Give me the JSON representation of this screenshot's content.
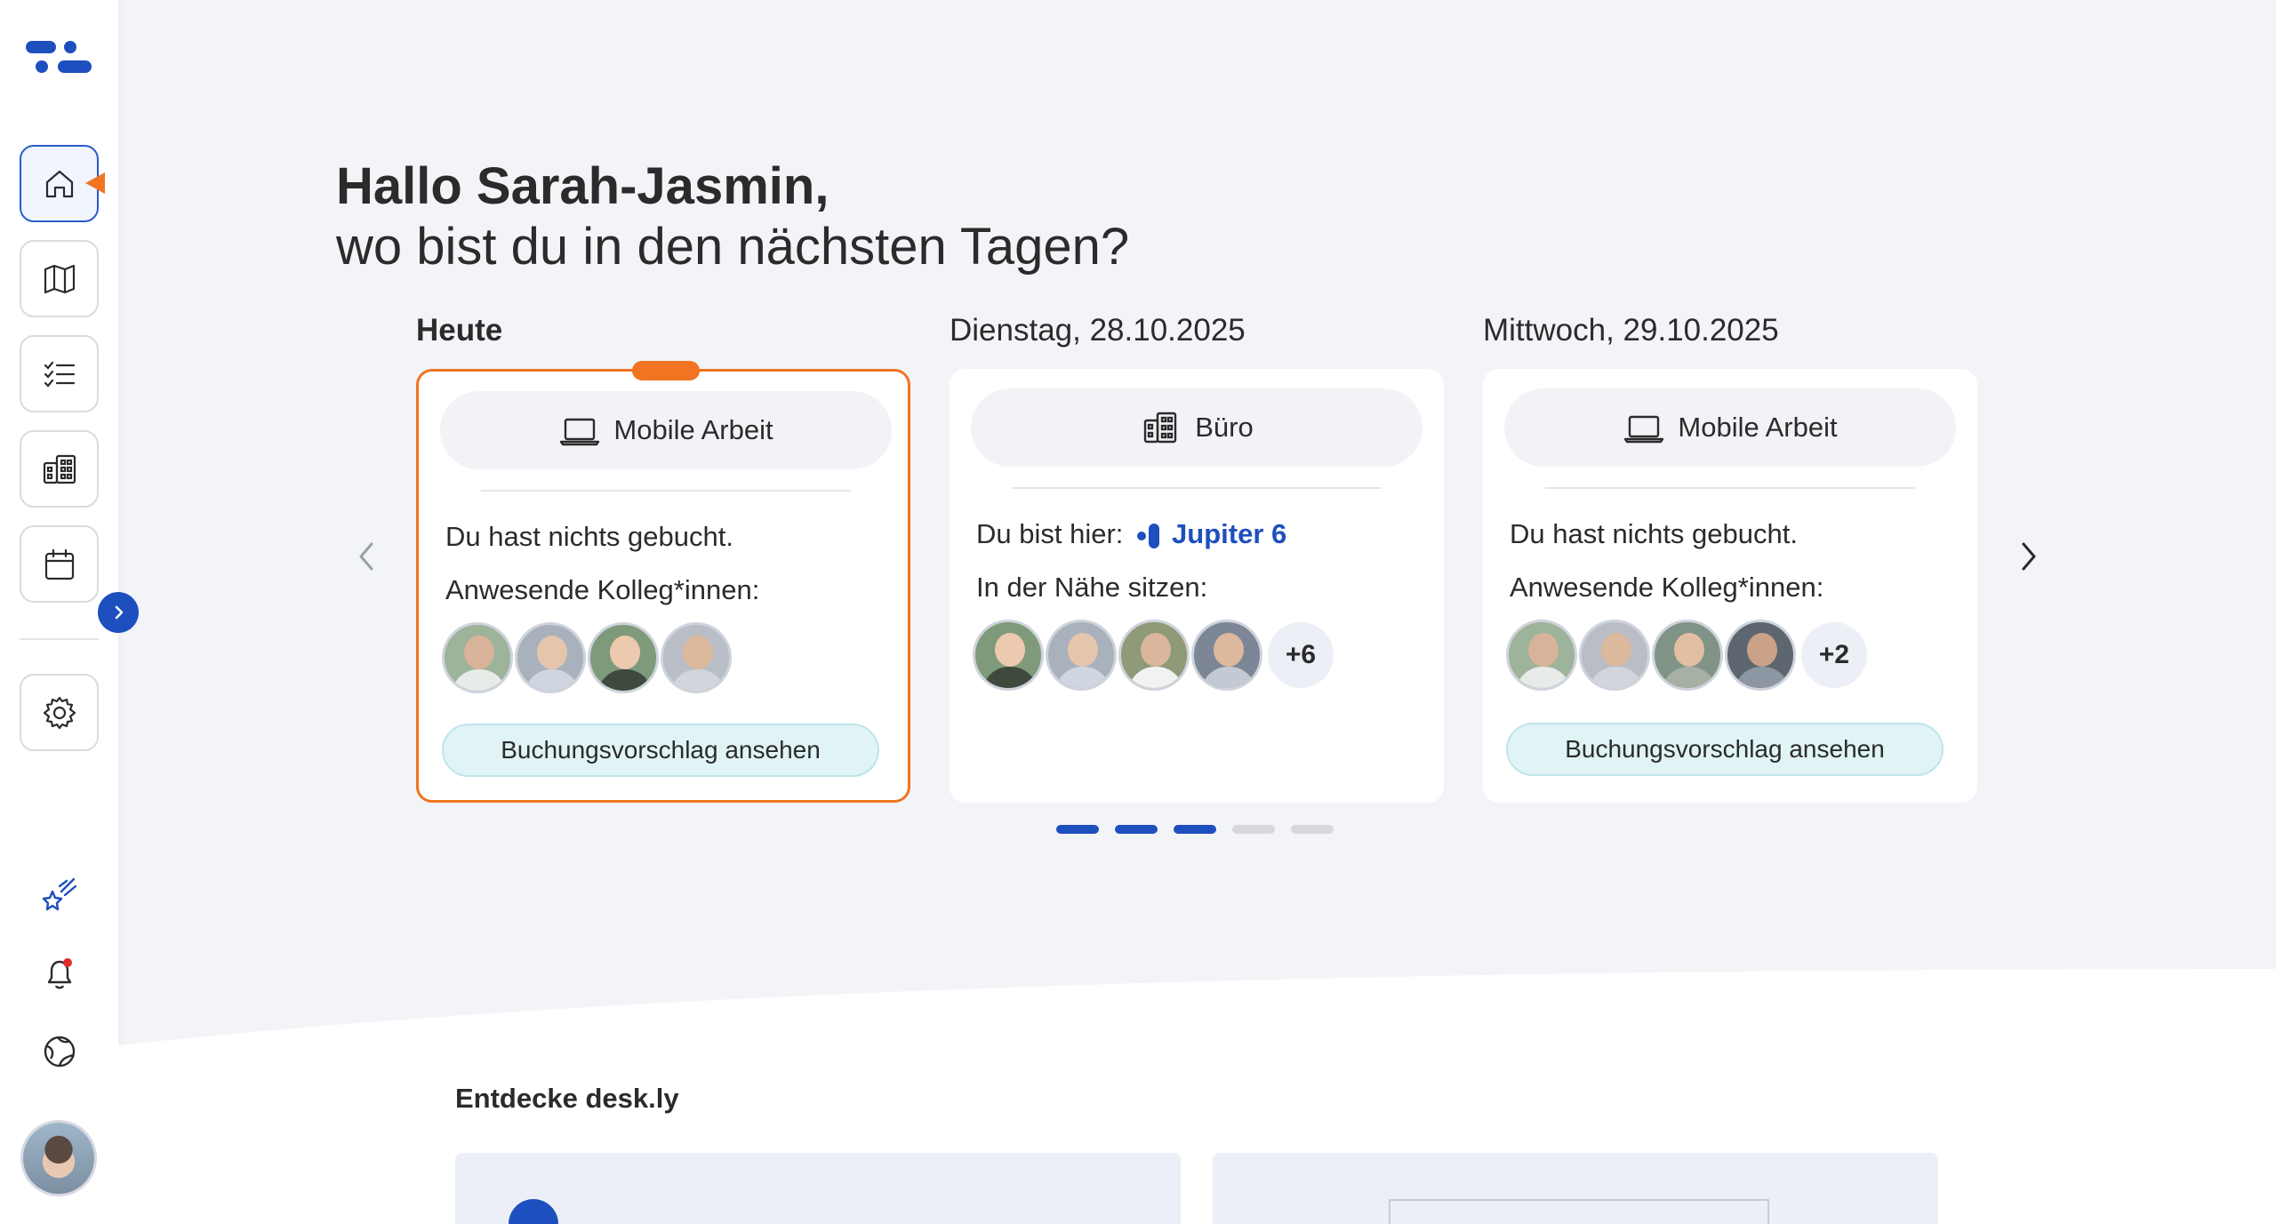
{
  "greeting": {
    "name_line": "Hallo Sarah-Jasmin,",
    "question_line": "wo bist du in den nächsten Tagen?"
  },
  "days": [
    {
      "label": "Heute",
      "mode": "Mobile Arbeit",
      "mode_icon": "laptop-icon",
      "status": "Du hast nichts gebucht.",
      "colleagues_label": "Anwesende Kolleg*innen:",
      "colleague_count_extra": "",
      "button": "Buchungsvorschlag ansehen"
    },
    {
      "label": "Dienstag, 28.10.2025",
      "mode": "Büro",
      "mode_icon": "office-building-icon",
      "status_prefix": "Du bist hier:",
      "location": "Jupiter 6",
      "colleagues_label": "In der Nähe sitzen:",
      "colleague_count_extra": "+6"
    },
    {
      "label": "Mittwoch, 29.10.2025",
      "mode": "Mobile Arbeit",
      "mode_icon": "laptop-icon",
      "status": "Du hast nichts gebucht.",
      "colleagues_label": "Anwesende Kolleg*innen:",
      "colleague_count_extra": "+2",
      "button": "Buchungsvorschlag ansehen"
    }
  ],
  "carousel": {
    "page_count": 5,
    "active_pages": 3
  },
  "discover": {
    "title": "Entdecke desk.ly"
  },
  "colors": {
    "accent": "#f07421",
    "brand": "#1e4fbf",
    "background": "#f3f4f8",
    "suggest_button": "#e0f3f5"
  },
  "sidebar": {
    "items": [
      "home-icon",
      "map-icon",
      "checklist-icon",
      "office-building-icon",
      "calendar-icon",
      "settings-icon"
    ],
    "bottom_items": [
      "whats-new-icon",
      "notification-bell-icon",
      "globe-icon"
    ]
  }
}
